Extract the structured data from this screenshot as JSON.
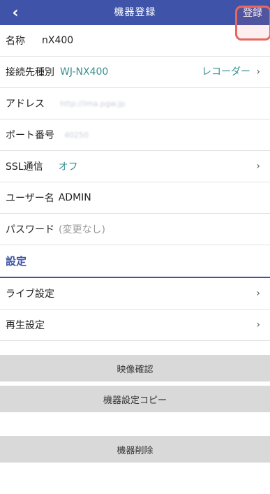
{
  "header": {
    "back_icon": "chevron-left-icon",
    "title": "機器登録",
    "register_label": "登録"
  },
  "form": {
    "name": {
      "label": "名称",
      "value": "nX400"
    },
    "connection_type": {
      "label": "接続先種別",
      "value": "WJ-NX400",
      "link": "レコーダー"
    },
    "address": {
      "label": "アドレス",
      "value": "http://ima.pgw.jp"
    },
    "port": {
      "label": "ポート番号",
      "value": "40250"
    },
    "ssl": {
      "label": "SSL通信",
      "value": "オフ"
    },
    "username": {
      "label": "ユーザー名",
      "value": "ADMIN"
    },
    "password": {
      "label": "パスワード",
      "value": "(変更なし)"
    }
  },
  "settings": {
    "section_title": "設定",
    "live": {
      "label": "ライブ設定"
    },
    "playback": {
      "label": "再生設定"
    }
  },
  "buttons": {
    "video_check": "映像確認",
    "copy_settings": "機器設定コピー",
    "delete": "機器削除"
  },
  "colors": {
    "header_bg": "#3f54a8",
    "teal_value": "#3a8f90",
    "highlight": "#e8665e",
    "button_bg": "#d9d9d9"
  }
}
